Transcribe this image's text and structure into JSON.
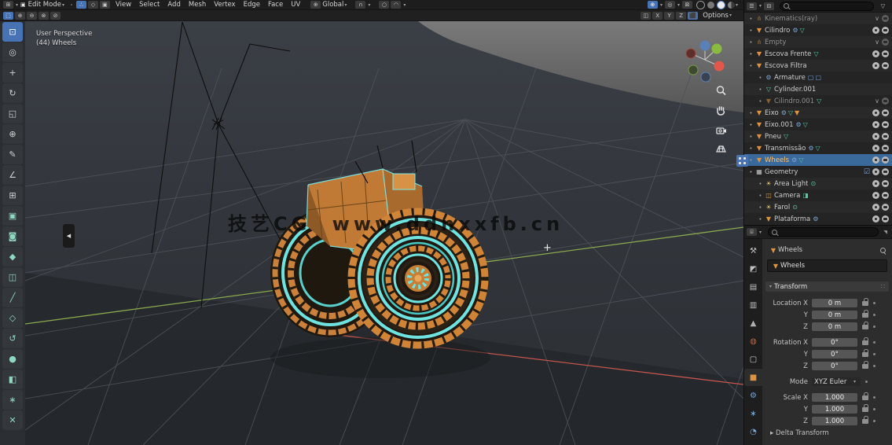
{
  "header": {
    "mode_label": "Edit Mode",
    "menus": [
      "View",
      "Select",
      "Add",
      "Mesh",
      "Vertex",
      "Edge",
      "Face",
      "UV"
    ],
    "orientation_label": "Global",
    "select_mode_icons": [
      "vertex-select-mode",
      "edge-select-mode",
      "face-select-mode"
    ],
    "shading_spheres": [
      "wireframe-shading",
      "solid-shading",
      "material-preview-shading",
      "rendered-shading"
    ],
    "mirror_axes": [
      "X",
      "Y",
      "Z"
    ],
    "options_label": "Options"
  },
  "toolbar": {
    "tools": [
      "select-box",
      "cursor",
      "move",
      "rotate",
      "scale",
      "transform",
      "annotate",
      "measure",
      "add-cube",
      "extrude-region",
      "inset-faces",
      "bevel",
      "loop-cut",
      "knife",
      "poly-build",
      "spin",
      "smooth",
      "edge-slide",
      "shrink-fatten",
      "rip-region"
    ],
    "active_tool": "select-box"
  },
  "viewport": {
    "view_label": "User Perspective",
    "object_label": "(44) Wheels",
    "watermark_brand": "技艺CG",
    "watermark_url": "www.ddnxxfb.cn",
    "nav_buttons": [
      "zoom-icon",
      "pan-hand-icon",
      "camera-view-icon",
      "orthographic-grid-icon"
    ],
    "gizmo_axes": [
      "X",
      "Y",
      "Z"
    ]
  },
  "outliner": {
    "rows": [
      {
        "label": "Kinematics(ray)",
        "icon": "armature",
        "dim": true,
        "indent": 0,
        "data_icons": [],
        "toggles": "hidden"
      },
      {
        "label": "Cilindro",
        "icon": "mesh-object",
        "indent": 0,
        "data_icons": [
          "modifier",
          "mesh-data"
        ],
        "toggles": "visible"
      },
      {
        "label": "Empty",
        "icon": "armature",
        "dim": true,
        "indent": 0,
        "data_icons": [],
        "toggles": "hidden"
      },
      {
        "label": "Escova Frente",
        "icon": "mesh-object",
        "indent": 0,
        "data_icons": [
          "mesh-data"
        ],
        "toggles": "visible"
      },
      {
        "label": "Escova Filtra",
        "icon": "mesh-object",
        "indent": 0,
        "data_icons": [],
        "toggles": "visible"
      },
      {
        "label": "Armature",
        "icon": "modifier",
        "indent": 1,
        "data_icons": [
          "panel",
          "panel"
        ],
        "toggles": "none"
      },
      {
        "label": "Cylinder.001",
        "icon": "mesh-data",
        "indent": 1,
        "data_icons": [],
        "toggles": "none"
      },
      {
        "label": "Cilindro.001",
        "icon": "mesh-object",
        "dim": true,
        "indent": 1,
        "data_icons": [
          "mesh-data"
        ],
        "toggles": "hidden"
      },
      {
        "label": "Eixo",
        "icon": "mesh-object",
        "indent": 0,
        "data_icons": [
          "modifier",
          "mesh-data",
          "mesh-object"
        ],
        "toggles": "visible"
      },
      {
        "label": "Eixo.001",
        "icon": "mesh-object",
        "indent": 0,
        "data_icons": [
          "modifier",
          "mesh-data"
        ],
        "toggles": "visible"
      },
      {
        "label": "Pneu",
        "icon": "mesh-object",
        "indent": 0,
        "data_icons": [
          "mesh-data"
        ],
        "toggles": "visible"
      },
      {
        "label": "Transmissão",
        "icon": "mesh-object",
        "indent": 0,
        "data_icons": [
          "modifier",
          "mesh-data"
        ],
        "toggles": "visible"
      },
      {
        "label": "Wheels",
        "icon": "mesh-object",
        "indent": 0,
        "selected": true,
        "active": true,
        "data_icons": [
          "modifier",
          "mesh-data"
        ],
        "toggles": "visible"
      },
      {
        "label": "Geometry",
        "icon": "collection",
        "indent": 0,
        "data_icons": [],
        "toggles": "collection"
      },
      {
        "label": "Area Light",
        "icon": "light",
        "indent": 1,
        "data_icons": [
          "light-data"
        ],
        "toggles": "visible"
      },
      {
        "label": "Camera",
        "icon": "camera",
        "indent": 1,
        "data_icons": [
          "camera-data"
        ],
        "toggles": "visible"
      },
      {
        "label": "Farol",
        "icon": "light",
        "indent": 1,
        "data_icons": [
          "light-data"
        ],
        "toggles": "visible"
      },
      {
        "label": "Plataforma",
        "icon": "mesh-object",
        "indent": 1,
        "data_icons": [
          "modifier"
        ],
        "toggles": "visible"
      }
    ]
  },
  "properties": {
    "tabs": [
      "tool",
      "render",
      "output",
      "view-layer",
      "scene",
      "world",
      "collection",
      "object",
      "modifiers",
      "particles",
      "physics"
    ],
    "active_tab": "object",
    "breadcrumb_object": "Wheels",
    "object_name": "Wheels",
    "transform": {
      "title": "Transform",
      "rows": [
        {
          "label": "Location X",
          "value": "0 m"
        },
        {
          "label": "Y",
          "value": "0 m"
        },
        {
          "label": "Z",
          "value": "0 m",
          "gap_after": true
        },
        {
          "label": "Rotation X",
          "value": "0°"
        },
        {
          "label": "Y",
          "value": "0°"
        },
        {
          "label": "Z",
          "value": "0°",
          "gap_after": true
        },
        {
          "label": "Mode",
          "value": "XYZ Euler",
          "type": "dropdown",
          "gap_after": true
        },
        {
          "label": "Scale X",
          "value": "1.000"
        },
        {
          "label": "Y",
          "value": "1.000"
        },
        {
          "label": "Z",
          "value": "1.000"
        }
      ],
      "delta_label": "Delta Transform"
    }
  },
  "colors": {
    "accent_blue": "#4772b3",
    "accent_orange": "#e0933f",
    "accent_teal": "#6fe3e0",
    "selected_row": "#3a6a9c",
    "axis_green": "#8aa84e",
    "axis_red": "#c4554d"
  }
}
